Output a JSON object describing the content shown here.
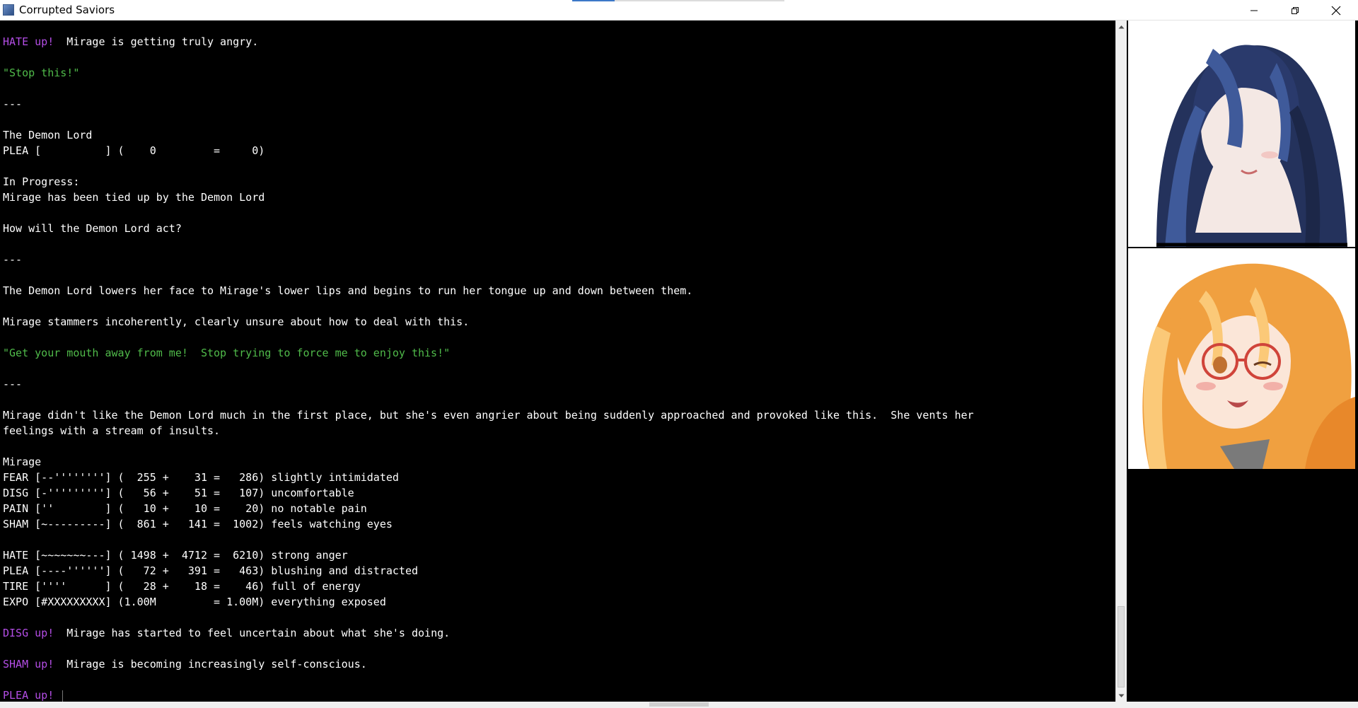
{
  "window": {
    "title": "Corrupted Saviors",
    "controls": [
      {
        "name": "minimize-button",
        "icon": "minimize-icon"
      },
      {
        "name": "restore-button",
        "icon": "restore-icon"
      },
      {
        "name": "close-button",
        "icon": "close-icon"
      }
    ]
  },
  "console": {
    "lines": [
      {
        "segments": [
          {
            "text": "HATE up!",
            "color": "purple"
          },
          {
            "text": "  Mirage is getting truly angry.",
            "color": "white"
          }
        ]
      },
      {
        "segments": []
      },
      {
        "segments": [
          {
            "text": "\"Stop this!\"",
            "color": "green"
          }
        ]
      },
      {
        "segments": []
      },
      {
        "segments": [
          {
            "text": "---",
            "color": "white"
          }
        ]
      },
      {
        "segments": []
      },
      {
        "segments": [
          {
            "text": "The Demon Lord",
            "color": "white"
          }
        ]
      },
      {
        "segments": [
          {
            "text": "PLEA [          ] (    0         =     0)",
            "color": "white"
          }
        ]
      },
      {
        "segments": []
      },
      {
        "segments": [
          {
            "text": "In Progress:",
            "color": "white"
          }
        ]
      },
      {
        "segments": [
          {
            "text": "Mirage has been tied up by the Demon Lord",
            "color": "white"
          }
        ]
      },
      {
        "segments": []
      },
      {
        "segments": [
          {
            "text": "How will the Demon Lord act?",
            "color": "white"
          }
        ]
      },
      {
        "segments": []
      },
      {
        "segments": [
          {
            "text": "---",
            "color": "white"
          }
        ]
      },
      {
        "segments": []
      },
      {
        "segments": [
          {
            "text": "The Demon Lord lowers her face to Mirage's lower lips and begins to run her tongue up and down between them.",
            "color": "white"
          }
        ]
      },
      {
        "segments": []
      },
      {
        "segments": [
          {
            "text": "Mirage stammers incoherently, clearly unsure about how to deal with this.",
            "color": "white"
          }
        ]
      },
      {
        "segments": []
      },
      {
        "segments": [
          {
            "text": "\"Get your mouth away from me!  Stop trying to force me to enjoy this!\"",
            "color": "green"
          }
        ]
      },
      {
        "segments": []
      },
      {
        "segments": [
          {
            "text": "---",
            "color": "white"
          }
        ]
      },
      {
        "segments": []
      },
      {
        "segments": [
          {
            "text": "Mirage didn't like the Demon Lord much in the first place, but she's even angrier about being suddenly approached and provoked like this.  She vents her",
            "color": "white"
          }
        ]
      },
      {
        "segments": [
          {
            "text": "feelings with a stream of insults.",
            "color": "white"
          }
        ]
      },
      {
        "segments": []
      },
      {
        "segments": [
          {
            "text": "Mirage",
            "color": "white"
          }
        ]
      },
      {
        "segments": [
          {
            "text": "FEAR [--''''''''] (  255 +    31 =   286) slightly intimidated",
            "color": "white"
          }
        ]
      },
      {
        "segments": [
          {
            "text": "DISG [-'''''''''] (   56 +    51 =   107) uncomfortable",
            "color": "white"
          }
        ]
      },
      {
        "segments": [
          {
            "text": "PAIN [''        ] (   10 +    10 =    20) no notable pain",
            "color": "white"
          }
        ]
      },
      {
        "segments": [
          {
            "text": "SHAM [~---------] (  861 +   141 =  1002) feels watching eyes",
            "color": "white"
          }
        ]
      },
      {
        "segments": []
      },
      {
        "segments": [
          {
            "text": "HATE [~~~~~~~---] ( 1498 +  4712 =  6210) strong anger",
            "color": "white"
          }
        ]
      },
      {
        "segments": [
          {
            "text": "PLEA [----''''''] (   72 +   391 =   463) blushing and distracted",
            "color": "white"
          }
        ]
      },
      {
        "segments": [
          {
            "text": "TIRE [''''      ] (   28 +    18 =    46) full of energy",
            "color": "white"
          }
        ]
      },
      {
        "segments": [
          {
            "text": "EXPO [#XXXXXXXXX] (1.00M         = 1.00M) everything exposed",
            "color": "white"
          }
        ]
      },
      {
        "segments": []
      },
      {
        "segments": [
          {
            "text": "DISG up!",
            "color": "purple"
          },
          {
            "text": "  Mirage has started to feel uncertain about what she's doing.",
            "color": "white"
          }
        ]
      },
      {
        "segments": []
      },
      {
        "segments": [
          {
            "text": "SHAM up!",
            "color": "purple"
          },
          {
            "text": "  Mirage is becoming increasingly self-conscious.",
            "color": "white"
          }
        ]
      },
      {
        "segments": []
      },
      {
        "segments": [
          {
            "text": "PLEA up!",
            "color": "purple"
          }
        ],
        "caret": true
      }
    ]
  },
  "portraits": [
    {
      "name": "portrait-demon-lord",
      "hair": "#24325c",
      "hair_light": "#3f5a9a",
      "skin": "#f4e8e4",
      "background": "#ffffff"
    },
    {
      "name": "portrait-mirage",
      "hair": "#f0a040",
      "hair_light": "#fbc978",
      "skin": "#fbe6d8",
      "background": "#ffffff",
      "glasses": "#d0443a"
    }
  ],
  "colors": {
    "console_bg": "#000000",
    "text_white": "#ffffff",
    "text_green": "#50bb4a",
    "text_purple": "#b44ee6"
  }
}
